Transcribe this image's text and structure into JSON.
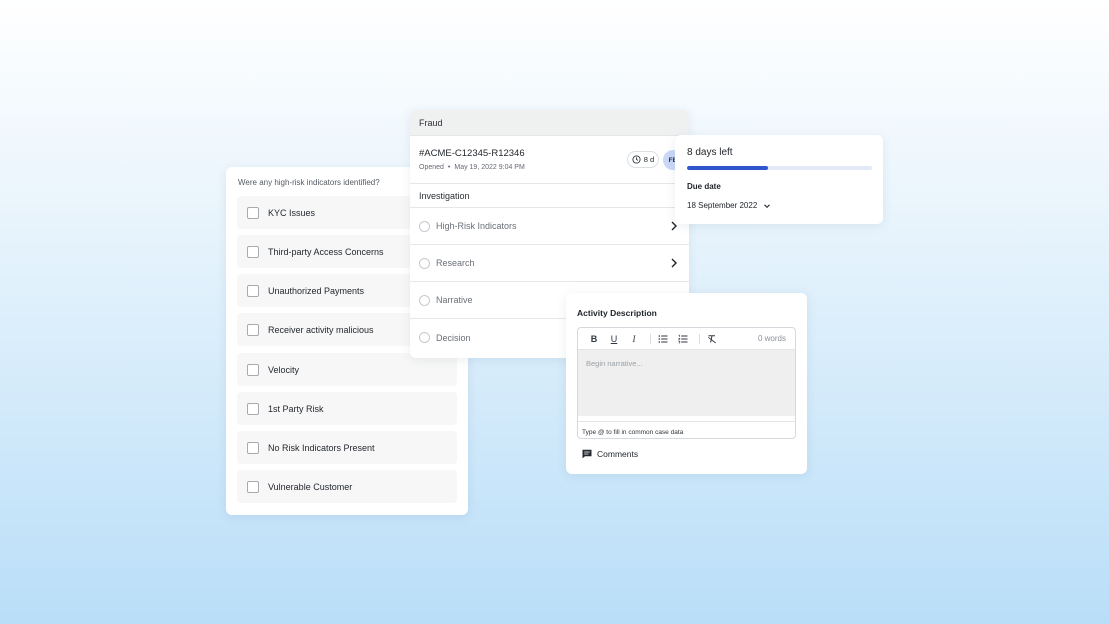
{
  "checklist": {
    "question": "Were any high-risk indicators identified?",
    "items": [
      {
        "label": "KYC Issues"
      },
      {
        "label": "Third-party Access Concerns"
      },
      {
        "label": "Unauthorized Payments"
      },
      {
        "label": "Receiver activity malicious"
      },
      {
        "label": "Velocity"
      },
      {
        "label": "1st Party Risk"
      },
      {
        "label": "No Risk Indicators Present"
      },
      {
        "label": "Vulnerable Customer"
      }
    ]
  },
  "case": {
    "category": "Fraud",
    "id": "#ACME-C12345-R12346",
    "opened_label": "Opened",
    "opened_date": "May 19, 2022 9:04 PM",
    "timer": "8 d",
    "assignee_initials": "FB",
    "section_title": "Investigation",
    "steps": [
      {
        "label": "High-Risk Indicators"
      },
      {
        "label": "Research"
      },
      {
        "label": "Narrative"
      },
      {
        "label": "Decision"
      }
    ]
  },
  "due": {
    "days_left": "8 days left",
    "progress_percent": 44,
    "label": "Due date",
    "date": "18 September 2022",
    "accent_color": "#3355cc"
  },
  "activity": {
    "title": "Activity Description",
    "toolbar": {
      "bold": "B",
      "underline": "U",
      "italic": "I"
    },
    "word_count": "0 words",
    "placeholder": "Begin narrative...",
    "hint": "Type @ to fill in common case data",
    "comments_label": "Comments"
  }
}
